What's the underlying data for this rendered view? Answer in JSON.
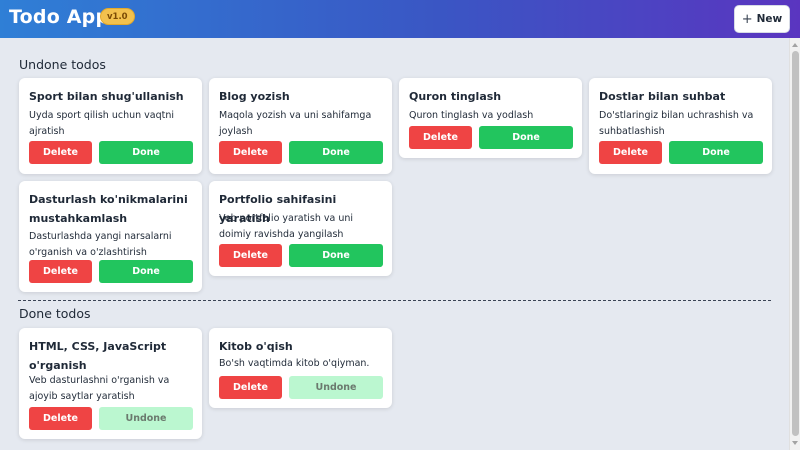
{
  "header": {
    "title": "Todo App",
    "version": "v1.0",
    "new_button_label": "New",
    "new_button_icon": "+"
  },
  "sections": {
    "undone_title": "Undone todos",
    "done_title": "Done todos"
  },
  "buttons": {
    "delete": "Delete",
    "done": "Done",
    "undone": "Undone"
  },
  "undone_todos": [
    {
      "title": "Sport bilan shug'ullanish",
      "description": "Uyda sport qilish uchun vaqtni ajratish"
    },
    {
      "title": "Blog yozish",
      "description": "Maqola yozish va uni sahifamga joylash"
    },
    {
      "title": "Quron tinglash",
      "description": "Quron tinglash va yodlash"
    },
    {
      "title": "Dostlar bilan suhbat",
      "description": "Do'stlaringiz bilan uchrashish va suhbatlashish"
    },
    {
      "title": "Dasturlash ko'nikmalarini mustahkamlash",
      "description": "Dasturlashda yangi narsalarni o'rganish va o'zlashtirish"
    },
    {
      "title": "Portfolio sahifasini yaratish",
      "description": "Veb portfolio yaratish va uni doimiy ravishda yangilash"
    }
  ],
  "done_todos": [
    {
      "title": "HTML, CSS, JavaScript o'rganish",
      "description": "Veb dasturlashni o'rganish va ajoyib saytlar yaratish"
    },
    {
      "title": "Kitob o'qish",
      "description": "Bo'sh vaqtimda kitob o'qiyman."
    }
  ],
  "colors": {
    "header_gradient_start": "#2f7fd6",
    "header_gradient_end": "#5a35c0",
    "badge": "#f2c14e",
    "delete": "#ef4444",
    "done": "#22c55e",
    "undone": "#bbf7d0",
    "background": "#e5e9f0"
  }
}
